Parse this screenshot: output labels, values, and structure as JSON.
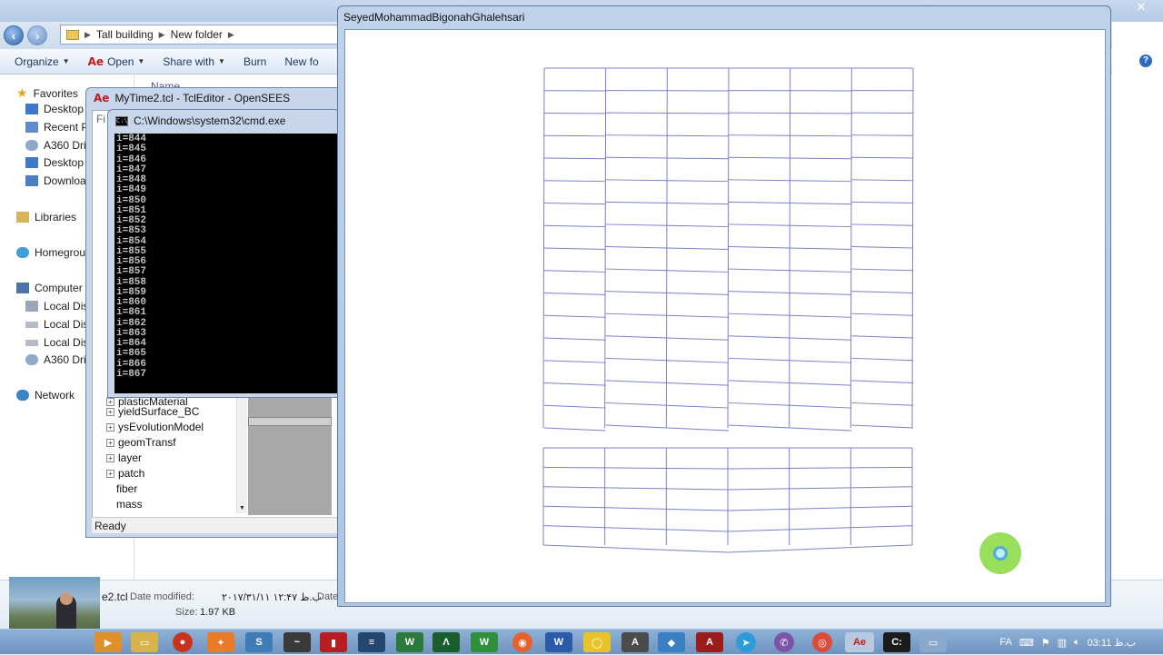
{
  "explorer": {
    "breadcrumbs": [
      "Tall building",
      "New folder"
    ],
    "toolbar": {
      "organize": "Organize",
      "open": "Open",
      "share_with": "Share with",
      "burn": "Burn",
      "new_folder": "New fo"
    },
    "column_header": "Name",
    "nav": {
      "favorites": "Favorites",
      "desktop": "Desktop",
      "recent_places": "Recent Pl",
      "a360_drive": "A360 Driv",
      "desktop2": "Desktop",
      "downloads": "Download",
      "libraries": "Libraries",
      "homegroup": "Homegrou",
      "computer": "Computer",
      "local_disk1": "Local Disl",
      "local_disk2": "Local Disl",
      "local_disk3": "Local Disl",
      "a360_drive2": "A360 Driv",
      "network": "Network"
    },
    "details": {
      "file_name": "e2.tcl",
      "date_modified_label": "Date modified:",
      "date_modified_value": "۲۰۱۷/۳۱/۱۱ ب.ظ ۱۲:۴۷",
      "date_label_2": "Date",
      "size_label": "Size:",
      "size_value": "1.97 KB"
    }
  },
  "tcl_editor": {
    "title": "MyTime2.tcl - TclEditor - OpenSEES",
    "menu_fragment": "Fi",
    "tree": [
      {
        "label": "plasticMaterial",
        "expander": true
      },
      {
        "label": "yieldSurface_BC",
        "expander": true
      },
      {
        "label": "ysEvolutionModel",
        "expander": true
      },
      {
        "label": "geomTransf",
        "expander": true
      },
      {
        "label": "layer",
        "expander": true
      },
      {
        "label": "patch",
        "expander": true
      },
      {
        "label": "fiber",
        "expander": false
      },
      {
        "label": "mass",
        "expander": false
      }
    ],
    "status": "Ready"
  },
  "cmd": {
    "title": "C:\\Windows\\system32\\cmd.exe",
    "lines": [
      "i=844",
      "i=845",
      "i=846",
      "i=847",
      "i=848",
      "i=849",
      "i=850",
      "i=851",
      "i=852",
      "i=853",
      "i=854",
      "i=855",
      "i=856",
      "i=857",
      "i=858",
      "i=859",
      "i=860",
      "i=861",
      "i=862",
      "i=863",
      "i=864",
      "i=865",
      "i=866",
      "i=867"
    ]
  },
  "opensees": {
    "title": "SeyedMohammadBigonahGhalehsari",
    "model": {
      "bays": 6,
      "stories_upper": 16,
      "stories_lower": 5,
      "line_color": "#7b7fd0"
    }
  },
  "taskbar": {
    "language": "FA",
    "clock": "03:11 ب.ظ"
  }
}
